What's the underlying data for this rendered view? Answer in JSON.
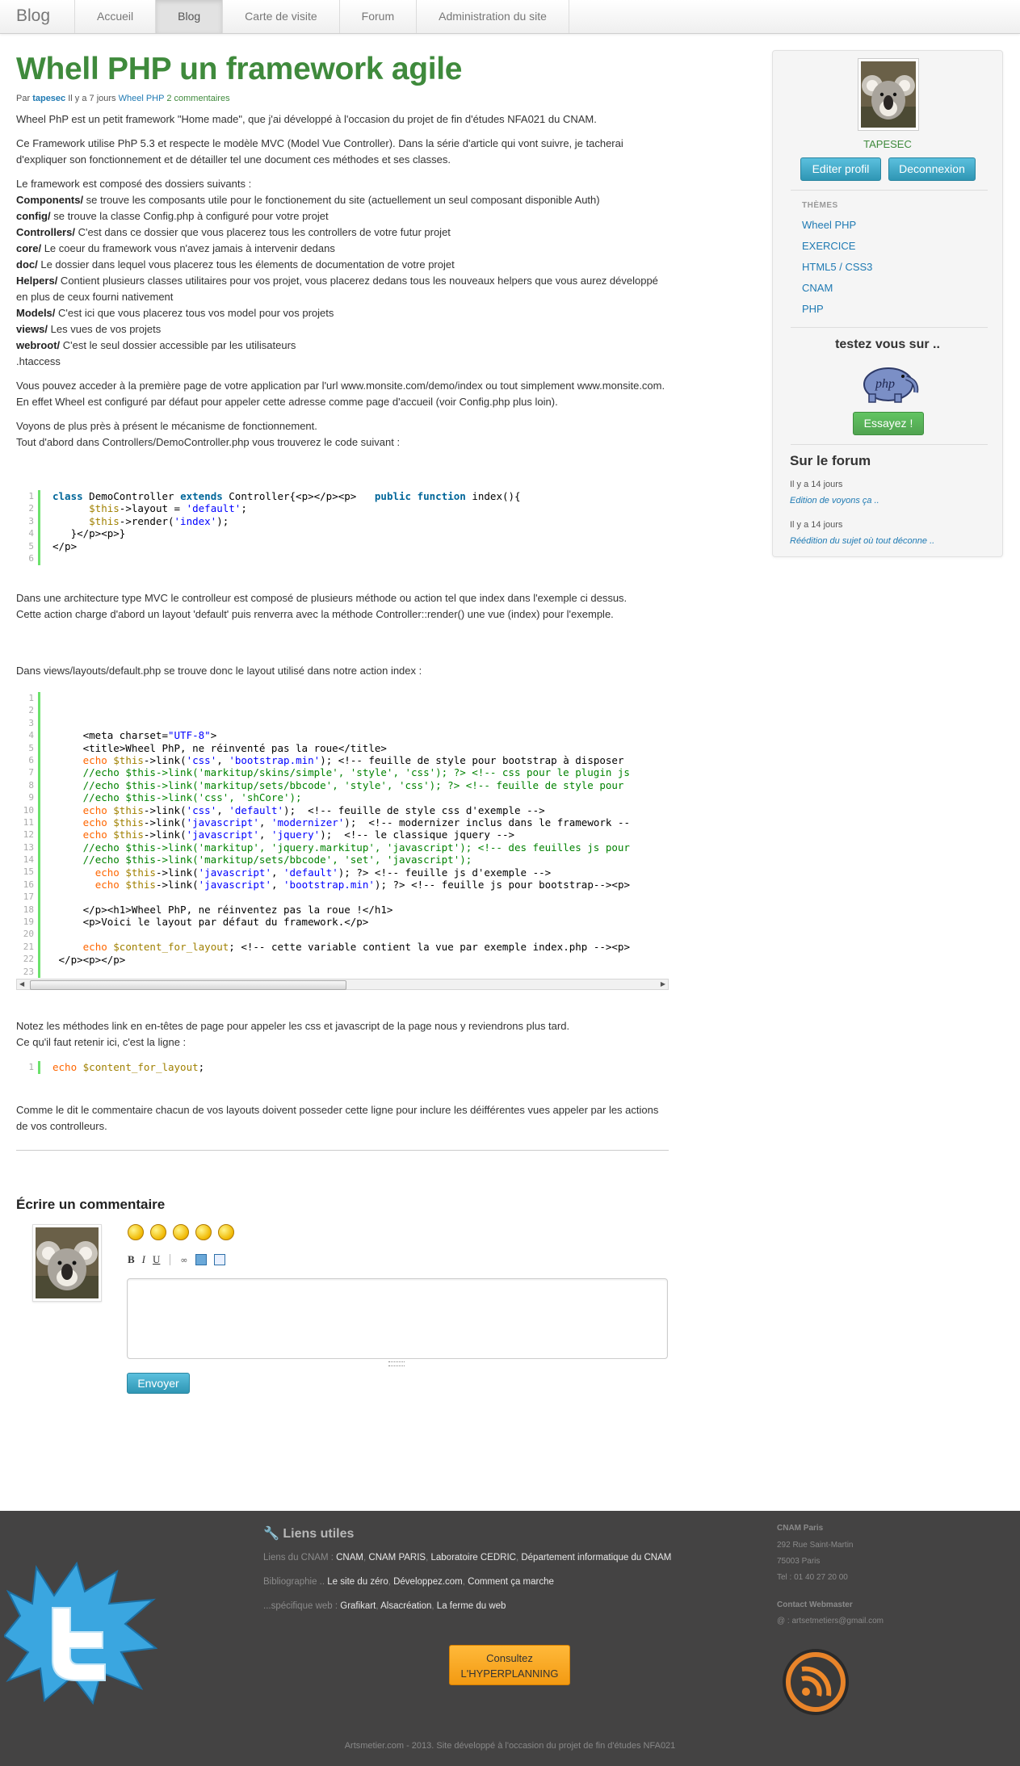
{
  "nav": {
    "brand": "Blog",
    "items": [
      "Accueil",
      "Blog",
      "Carte de visite",
      "Forum",
      "Administration du site"
    ],
    "active": "Blog"
  },
  "article": {
    "title": "Whell PHP un framework agile",
    "meta": {
      "prefix": "Par",
      "author": "tapesec",
      "time": "Il y a 7 jours",
      "category": "Wheel PHP",
      "comments": "2 commentaires"
    },
    "intro1": "Wheel PhP est un petit framework \"Home made\", que j'ai développé à l'occasion du projet de fin d'études NFA021 du CNAM.",
    "intro2": "Ce Framework utilise PhP 5.3 et respecte le modèle MVC (Model Vue Controller). Dans la série d'article qui vont suivre, je tacherai d'expliquer son fonctionnement et de détailler tel une document ces méthodes et ses classes.",
    "folders_intro": "Le framework est composé des dossiers suivants :",
    "folders": [
      {
        "name": "Components/",
        "desc": " se trouve les composants utile pour le fonctionement du site (actuellement un seul composant disponible Auth)"
      },
      {
        "name": "config/",
        "desc": " se trouve la classe Config.php à configuré pour votre projet"
      },
      {
        "name": "Controllers/",
        "desc": " C'est dans ce dossier que vous placerez tous les controllers de votre futur projet"
      },
      {
        "name": "core/",
        "desc": " Le coeur du framework vous n'avez jamais à intervenir dedans"
      },
      {
        "name": "doc/",
        "desc": " Le dossier dans lequel vous placerez tous les élements de documentation de votre projet"
      },
      {
        "name": "Helpers/",
        "desc": " Contient plusieurs classes utilitaires pour vos projet, vous placerez dedans tous les nouveaux helpers que vous aurez développé en plus de ceux fourni nativement"
      },
      {
        "name": "Models/",
        "desc": " C'est ici que vous placerez tous vos model pour vos projets"
      },
      {
        "name": "views/",
        "desc": " Les vues de vos projets"
      },
      {
        "name": "webroot/",
        "desc": " C'est le seul dossier accessible par les utilisateurs"
      }
    ],
    "htaccess": ".htaccess",
    "p_access": "Vous pouvez acceder à la première page de votre application par l'url www.monsite.com/demo/index ou tout simplement www.monsite.com. En effet Wheel est configuré par défaut pour appeler cette adresse comme page d'accueil (voir Config.php plus loin).",
    "p_voyons1": "Voyons de plus près à présent le mécanisme de fonctionnement.",
    "p_voyons2": "Tout d'abord dans Controllers/DemoController.php vous trouverez le code suivant :",
    "p_mvc1": "Dans une architecture type MVC le controlleur est composé de plusieurs méthode ou action tel que index dans l'exemple ci dessus.",
    "p_mvc2": "Cette action charge d'abord un layout 'default' puis renverra avec la méthode Controller::render() une vue (index) pour l'exemple.",
    "p_layout": "Dans views/layouts/default.php se trouve donc le layout utilisé dans notre action index :",
    "p_notez1": "Notez les méthodes link en en-têtes de page pour appeler les css et javascript de la page nous y reviendrons plus tard.",
    "p_notez2": "Ce qu'il faut retenir ici, c'est la ligne :",
    "p_comme": "Comme le dit le commentaire chacun de vos layouts doivent posseder cette ligne pour inclure les déifférentes vues appeler par les actions de vos controlleurs."
  },
  "comment_form": {
    "title": "Écrire un commentaire",
    "toolbar": [
      "B",
      "I",
      "U"
    ],
    "submit": "Envoyer",
    "textarea_value": ""
  },
  "sidebar": {
    "username": "TAPESEC",
    "edit_profile": "Editer profil",
    "logout": "Deconnexion",
    "themes_heading": "THÈMES",
    "themes": [
      "Wheel PHP",
      "EXERCICE",
      "HTML5 / CSS3",
      "CNAM",
      "PHP"
    ],
    "test_title": "testez vous sur ..",
    "php_logo_text": "php",
    "try_button": "Essayez !",
    "forum_title": "Sur le forum",
    "forum_posts": [
      {
        "time": "Il y a 14 jours",
        "title": "Edition de voyons ça .."
      },
      {
        "time": "Il y a 14 jours",
        "title": "Réédition du sujet où tout déconne .."
      }
    ]
  },
  "footer": {
    "title": "Liens utiles",
    "rows": [
      {
        "label": "Liens du CNAM : ",
        "links": [
          "CNAM",
          "CNAM PARIS",
          "Laboratoire CEDRIC",
          "Département informatique du CNAM"
        ]
      },
      {
        "label": "Bibliographie .. ",
        "links": [
          "Le site du zéro",
          "Développez.com",
          "Comment ça marche"
        ]
      },
      {
        "label": "...spécifique web : ",
        "links": [
          "Grafikart",
          "Alsacréation",
          "La ferme du web"
        ]
      }
    ],
    "hyperplanning_line1": "Consultez",
    "hyperplanning_line2": "L'HYPERPLANNING",
    "address": {
      "name": "CNAM Paris",
      "street": "292 Rue Saint-Martin",
      "city": "75003 Paris",
      "phone": "Tel : 01 40 27 20 00"
    },
    "contact_title": "Contact Webmaster",
    "contact_email": "@ : artsetmetiers@gmail.com",
    "copyright": "Artsmetier.com - 2013. Site développé à l'occasion du projet de fin d'études NFA021"
  },
  "colors": {
    "title_green": "#3f8a3c",
    "link_blue": "#1f7ab3",
    "code_bar": "#6ce26c",
    "footer_bg": "#444343",
    "button_blue": "#2f96b4",
    "button_green": "#51a351",
    "hyperplanning_orange": "#f39a12"
  },
  "icons": [
    "wrench-icon",
    "twitter-bird-icon",
    "rss-icon",
    "php-elephant-icon",
    "koala-avatar"
  ]
}
